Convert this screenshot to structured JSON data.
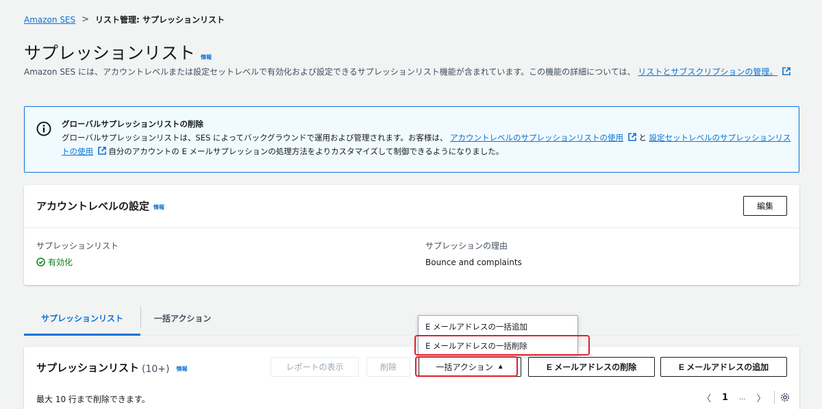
{
  "breadcrumb": {
    "root": "Amazon SES",
    "separator": ">",
    "current": "リスト管理: サプレッションリスト"
  },
  "page": {
    "title": "サプレッションリスト",
    "info": "情報",
    "description_text": "Amazon SES には、アカウントレベルまたは設定セットレベルで有効化および設定できるサプレッションリスト機能が含まれています。この機能の詳細については、",
    "description_link": "リストとサブスクリプションの管理。"
  },
  "alert": {
    "title": "グローバルサプレッションリストの削除",
    "text1": "グローバルサプレッションリストは、SES によってバックグラウンドで運用および管理されます。お客様は、",
    "link1": "アカウントレベルのサプレッションリストの使用",
    "text2": " と ",
    "link2": "設定セットレベルのサプレッションリストの使用",
    "text3": " 自分のアカウントの E メールサプレッションの処理方法をよりカスタマイズして制御できるようになりました。"
  },
  "account": {
    "title": "アカウントレベルの設定",
    "info": "情報",
    "edit": "編集",
    "list_label": "サプレッションリスト",
    "list_value": "有効化",
    "reason_label": "サプレッションの理由",
    "reason_value": "Bounce and complaints"
  },
  "tabs": [
    "サプレッションリスト",
    "一括アクション"
  ],
  "list": {
    "title": "サプレッションリスト",
    "count": "(10+)",
    "info": "情報",
    "report": "レポートの表示",
    "delete": "削除",
    "bulk": "一括アクション",
    "bulk_caret": "▲",
    "delete_email": "E メールアドレスの削除",
    "add_email": "E メールアドレスの追加",
    "note": "最大 10 行まで削除できます。",
    "pager": {
      "prev": "〈",
      "page": "1",
      "ellipsis": "...",
      "next": "〉"
    }
  },
  "bulk_menu": [
    "E メールアドレスの一括追加",
    "E メールアドレスの一括削除"
  ],
  "icons": {
    "info": "info-circle-icon",
    "external": "external-link-icon",
    "status": "check-circle-icon",
    "settings": "gear-icon"
  },
  "colors": {
    "accent": "#0972d3",
    "success": "#037f0c",
    "highlight": "#e11d2a",
    "alert_bg": "#f1faff"
  }
}
